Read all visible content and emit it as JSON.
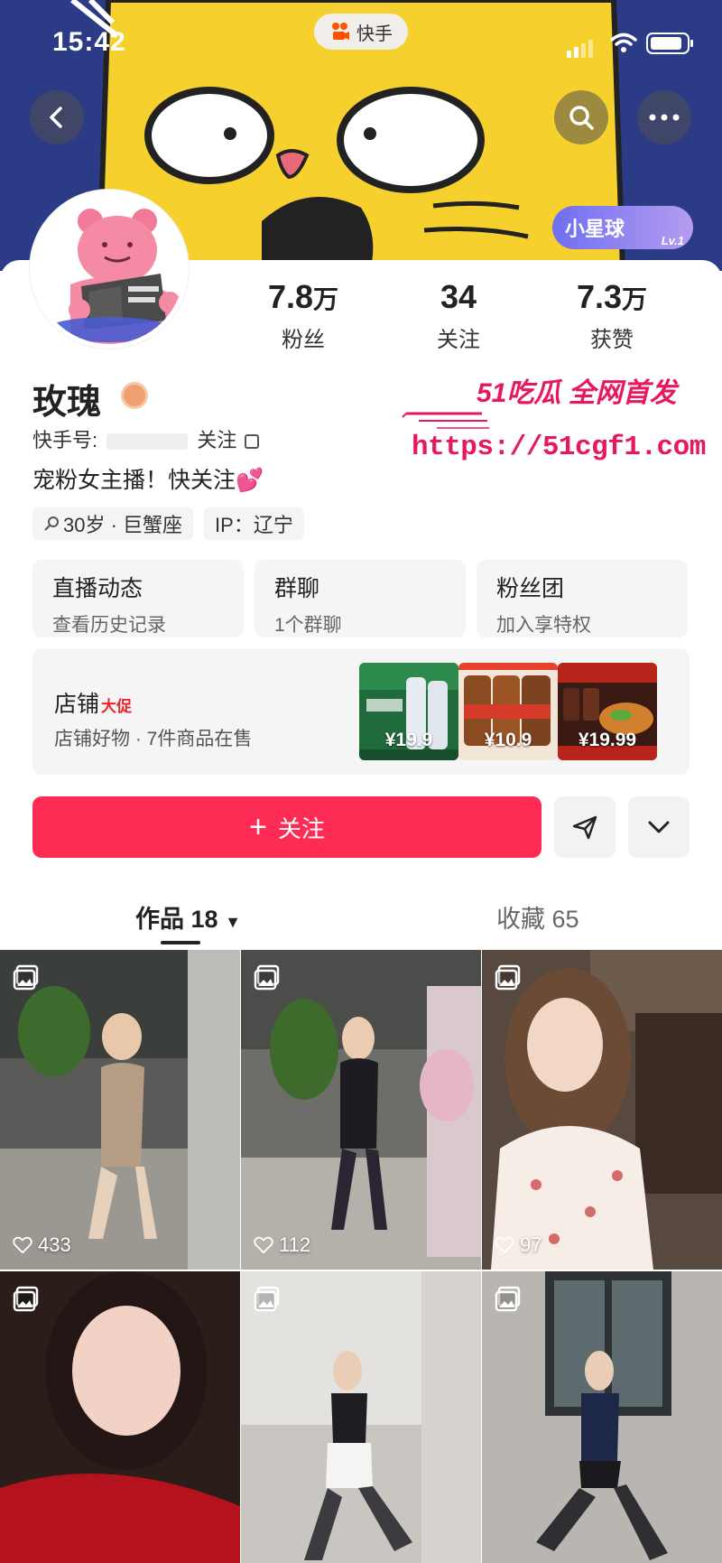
{
  "status": {
    "time": "15:42",
    "app_name": "快手"
  },
  "header": {
    "planet_badge": "小星球",
    "planet_level": "Lv.1"
  },
  "profile": {
    "name": "玫瑰",
    "kuaishou_id_label": "快手号:",
    "kuaishou_id_value": "关注",
    "bio": "宠粉女主播！快关注💕",
    "tags": [
      "30岁 · 巨蟹座",
      "IP：辽宁"
    ]
  },
  "stats": [
    {
      "value": "7.8",
      "unit": "万",
      "label": "粉丝"
    },
    {
      "value": "34",
      "unit": "",
      "label": "关注"
    },
    {
      "value": "7.3",
      "unit": "万",
      "label": "获赞"
    }
  ],
  "watermark": {
    "top": "51吃瓜 全网首发",
    "url": "https://51cgf1.com"
  },
  "features": [
    {
      "title": "直播动态",
      "subtitle": "查看历史记录"
    },
    {
      "title": "群聊",
      "subtitle": "1个群聊"
    },
    {
      "title": "粉丝团",
      "subtitle": "加入享特权"
    }
  ],
  "shop": {
    "title": "店铺",
    "promo": "大促",
    "subtitle": "店铺好物 · 7件商品在售",
    "products": [
      {
        "price": "¥19.9"
      },
      {
        "price": "¥10.9"
      },
      {
        "price": "¥19.99"
      }
    ]
  },
  "actions": {
    "follow_label": "关注"
  },
  "tabs": {
    "works_label": "作品 18",
    "favorites_label": "收藏 65"
  },
  "posts": [
    {
      "likes": "433"
    },
    {
      "likes": "112"
    },
    {
      "likes": "97"
    },
    {
      "likes": ""
    },
    {
      "likes": ""
    },
    {
      "likes": ""
    }
  ],
  "colors": {
    "accent": "#fe2c55",
    "watermark": "#e8185f",
    "banner_yellow": "#f6d12e"
  }
}
